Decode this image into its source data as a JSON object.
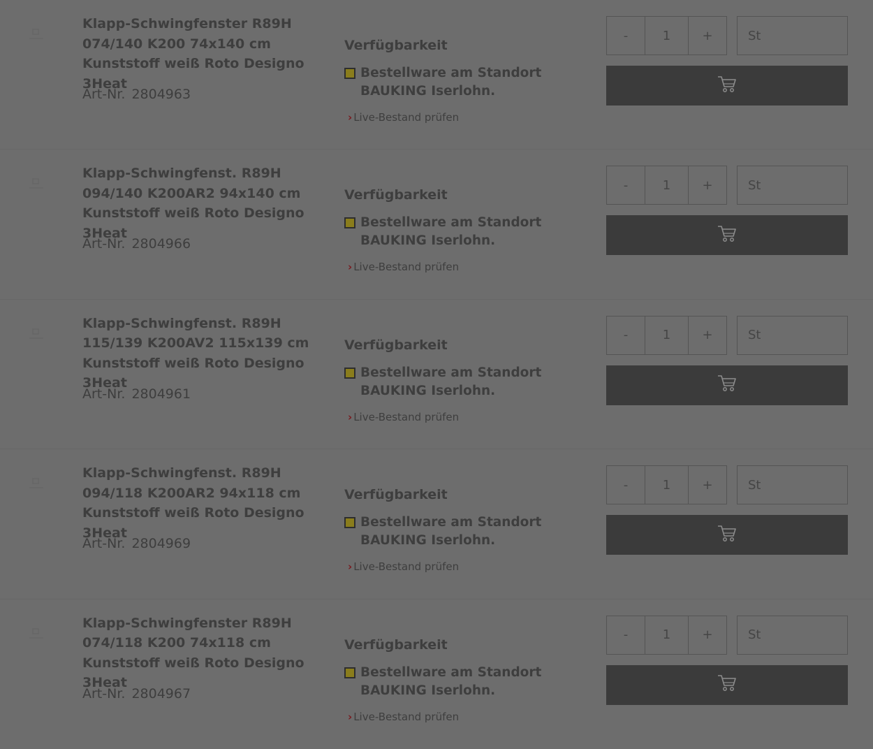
{
  "labels": {
    "art_nr": "Art-Nr.",
    "availability_title": "Verfügbarkeit",
    "live_stock_link": "Live-Bestand prüfen",
    "qty_minus": "-",
    "qty_plus": "+"
  },
  "colors": {
    "status_order_item": "#8a7d1c",
    "cart_button": "#3b3b3b",
    "link_chevron": "#7a1a1f"
  },
  "icons": {
    "product_image": "image-placeholder-icon",
    "cart": "cart-icon",
    "link": "chevron-right-icon"
  },
  "products": [
    {
      "title": "Klapp-Schwingfenster R89H 074/140 K200 74x140 cm Kunststoff weiß Roto Designo 3Heat",
      "art_nr": "2804963",
      "status": "Bestellware am Standort BAUKING Iserlohn.",
      "quantity": "1",
      "unit": "St"
    },
    {
      "title": "Klapp-Schwingfenst. R89H 094/140 K200AR2 94x140 cm Kunststoff weiß Roto Designo 3Heat",
      "art_nr": "2804966",
      "status": "Bestellware am Standort BAUKING Iserlohn.",
      "quantity": "1",
      "unit": "St"
    },
    {
      "title": "Klapp-Schwingfenst. R89H 115/139 K200AV2 115x139 cm Kunststoff weiß Roto Designo 3Heat",
      "art_nr": "2804961",
      "status": "Bestellware am Standort BAUKING Iserlohn.",
      "quantity": "1",
      "unit": "St"
    },
    {
      "title": "Klapp-Schwingfenst. R89H 094/118 K200AR2 94x118 cm Kunststoff weiß Roto Designo 3Heat",
      "art_nr": "2804969",
      "status": "Bestellware am Standort BAUKING Iserlohn.",
      "quantity": "1",
      "unit": "St"
    },
    {
      "title": "Klapp-Schwingfenster R89H 074/118 K200 74x118 cm Kunststoff weiß Roto Designo 3Heat",
      "art_nr": "2804967",
      "status": "Bestellware am Standort BAUKING Iserlohn.",
      "quantity": "1",
      "unit": "St"
    }
  ]
}
